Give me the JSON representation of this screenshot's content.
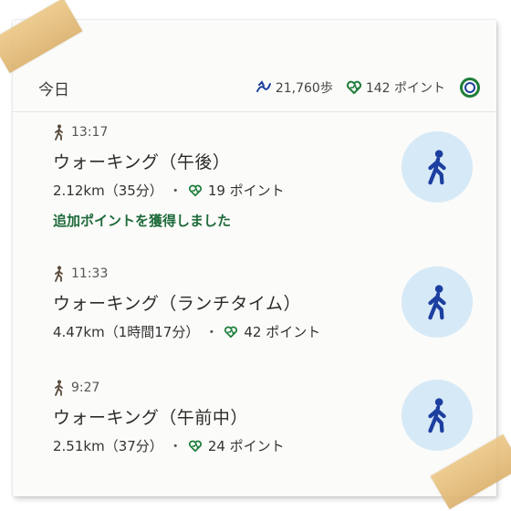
{
  "header": {
    "title": "今日",
    "steps": "21,760歩",
    "points": "142 ポイント"
  },
  "activities": [
    {
      "time": "13:17",
      "name": "ウォーキング（午後）",
      "distance": "2.12km（35分）",
      "points": "19 ポイント",
      "extra": "追加ポイントを獲得しました"
    },
    {
      "time": "11:33",
      "name": "ウォーキング（ランチタイム）",
      "distance": "4.47km（1時間17分）",
      "points": "42 ポイント"
    },
    {
      "time": "9:27",
      "name": "ウォーキング（午前中）",
      "distance": "2.51km（37分）",
      "points": "24 ポイント"
    }
  ],
  "icons": {
    "walk_small": "walk-icon",
    "walk_large": "walk-icon",
    "heart": "heart-points-icon",
    "steps": "steps-icon",
    "ring": "activity-ring-icon"
  },
  "colors": {
    "green": "#1e7d3a",
    "blue": "#1d3fa0",
    "circle_bg": "#d6e9f6"
  }
}
